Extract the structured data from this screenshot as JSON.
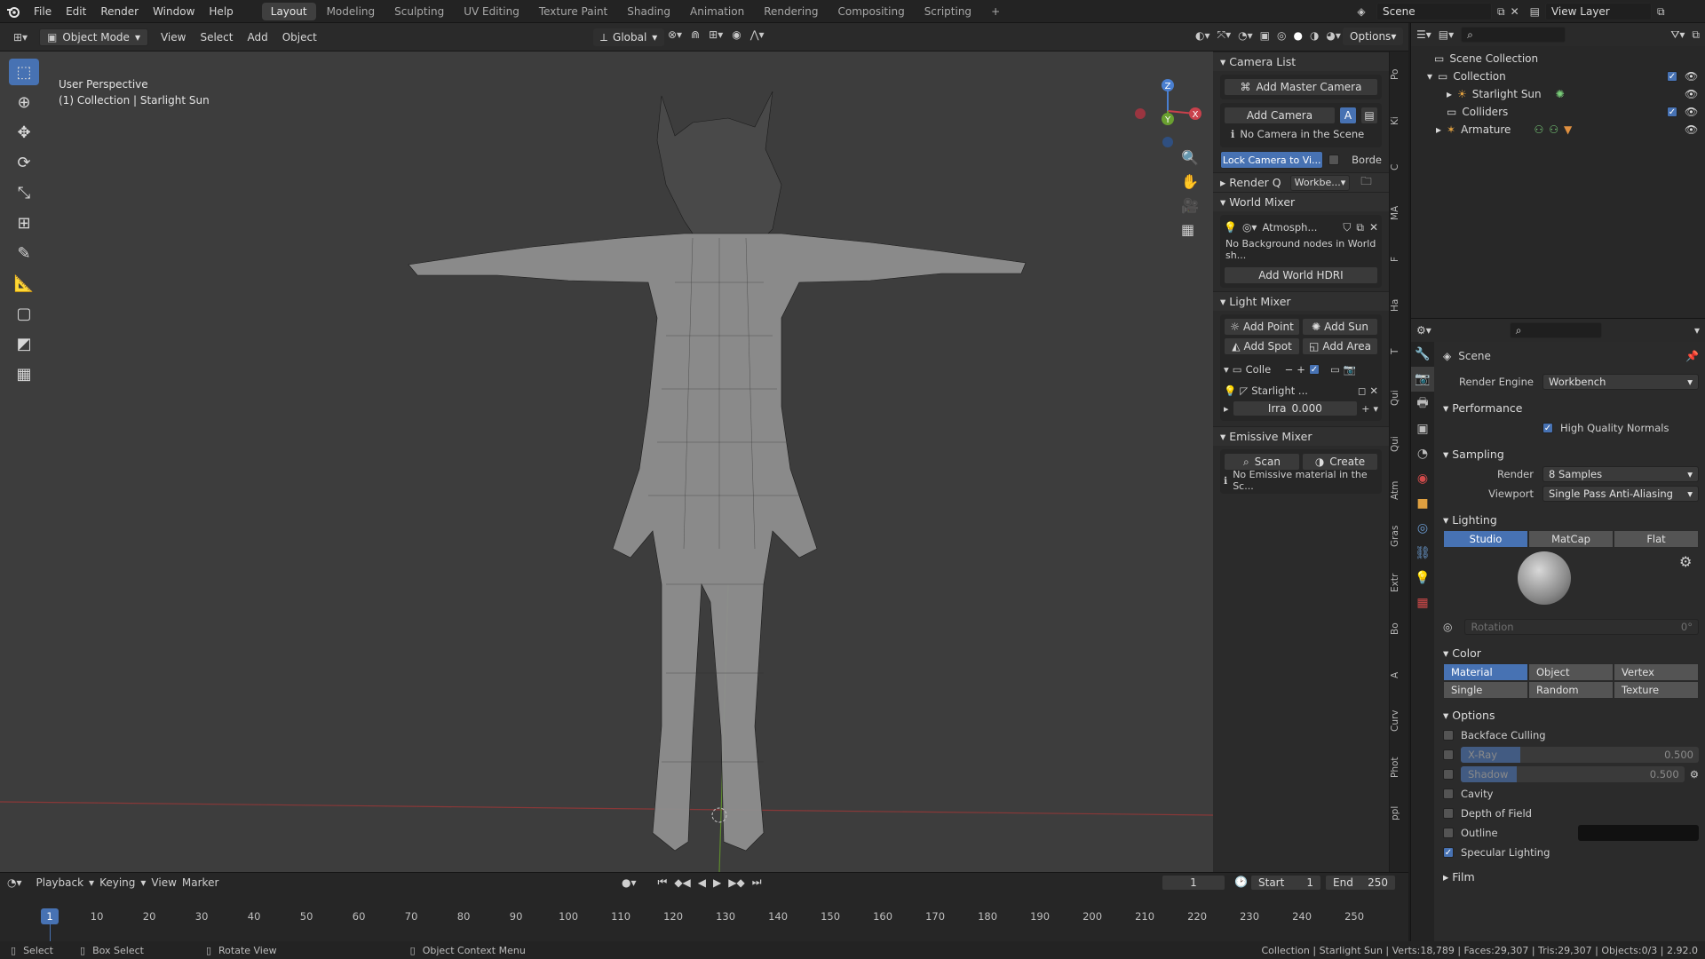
{
  "topbar": {
    "menus": [
      "File",
      "Edit",
      "Render",
      "Window",
      "Help"
    ],
    "workspaces": [
      "Layout",
      "Modeling",
      "Sculpting",
      "UV Editing",
      "Texture Paint",
      "Shading",
      "Animation",
      "Rendering",
      "Compositing",
      "Scripting"
    ],
    "active_workspace": "Layout",
    "add_tab": "+",
    "scene_name": "Scene",
    "view_layer": "View Layer"
  },
  "viewport_header": {
    "mode": "Object Mode",
    "menus": [
      "View",
      "Select",
      "Add",
      "Object"
    ],
    "orientation": "Global",
    "options": "Options"
  },
  "viewport": {
    "perspective": "User Perspective",
    "context": "(1) Collection | Starlight Sun",
    "gizmo_x": "X",
    "gizmo_y": "Y",
    "gizmo_z": "Z"
  },
  "npanel": {
    "camera_list": "Camera List",
    "add_master_camera": "Add Master Camera",
    "add_camera": "Add Camera",
    "no_camera": "No Camera in the Scene",
    "lock_camera": "Lock Camera to Vi...",
    "border": "Borde",
    "render_q": "Render Q",
    "render_q_value": "Workbe...",
    "world_mixer": "World Mixer",
    "world_name": "Atmosph...",
    "no_background": "No Background nodes in World sh...",
    "add_world_hdri": "Add World HDRI",
    "light_mixer": "Light Mixer",
    "add_point": "Add Point",
    "add_sun": "Add Sun",
    "add_spot": "Add Spot",
    "add_area": "Add Area",
    "colle": "Colle",
    "light_name": "Starlight ...",
    "irra_label": "Irra",
    "irra_value": "0.000",
    "emissive_mixer": "Emissive Mixer",
    "scan": "Scan",
    "create": "Create",
    "no_emissive": "No Emissive material in the Sc..."
  },
  "side_tabs": [
    "Po",
    "Ki",
    "C",
    "MA",
    "F",
    "Ha",
    "T",
    "Qui",
    "Qui",
    "Atm",
    "Gras",
    "Extr",
    "Bo",
    "A",
    "Curv",
    "Phot",
    "ppl"
  ],
  "outliner": {
    "items": [
      {
        "label": "Scene Collection"
      },
      {
        "label": "Collection"
      },
      {
        "label": "Starlight Sun"
      },
      {
        "label": "Colliders"
      },
      {
        "label": "Armature"
      }
    ]
  },
  "properties": {
    "context": "Scene",
    "render_engine_label": "Render Engine",
    "render_engine": "Workbench",
    "performance": "Performance",
    "high_quality_normals": "High Quality Normals",
    "sampling": "Sampling",
    "render_label": "Render",
    "render_samples": "8 Samples",
    "viewport_label": "Viewport",
    "viewport_aa": "Single Pass Anti-Aliasing",
    "lighting": "Lighting",
    "lighting_modes": [
      "Studio",
      "MatCap",
      "Flat"
    ],
    "rotation_label": "Rotation",
    "rotation_value": "0°",
    "color": "Color",
    "color_modes_1": [
      "Material",
      "Object",
      "Vertex"
    ],
    "color_modes_2": [
      "Single",
      "Random",
      "Texture"
    ],
    "options": "Options",
    "backface_culling": "Backface Culling",
    "xray": "X-Ray",
    "xray_value": "0.500",
    "xray_fraction": 0.5,
    "shadow": "Shadow",
    "shadow_value": "0.500",
    "shadow_fraction": 0.5,
    "cavity": "Cavity",
    "depth_of_field": "Depth of Field",
    "outline": "Outline",
    "specular_lighting": "Specular Lighting",
    "film": "Film"
  },
  "timeline": {
    "menus": [
      "Playback",
      "Keying",
      "View",
      "Marker"
    ],
    "current_frame": "1",
    "start_label": "Start",
    "start": "1",
    "end_label": "End",
    "end": "250",
    "ticks": [
      "1",
      "10",
      "20",
      "30",
      "40",
      "50",
      "60",
      "70",
      "80",
      "90",
      "100",
      "110",
      "120",
      "130",
      "140",
      "150",
      "160",
      "170",
      "180",
      "190",
      "200",
      "210",
      "220",
      "230",
      "240",
      "250"
    ]
  },
  "status": {
    "select": "Select",
    "box_select": "Box Select",
    "rotate_view": "Rotate View",
    "context_menu": "Object Context Menu",
    "stats": "Collection | Starlight Sun | Verts:18,789 | Faces:29,307 | Tris:29,307 | Objects:0/3 | 2.92.0"
  }
}
